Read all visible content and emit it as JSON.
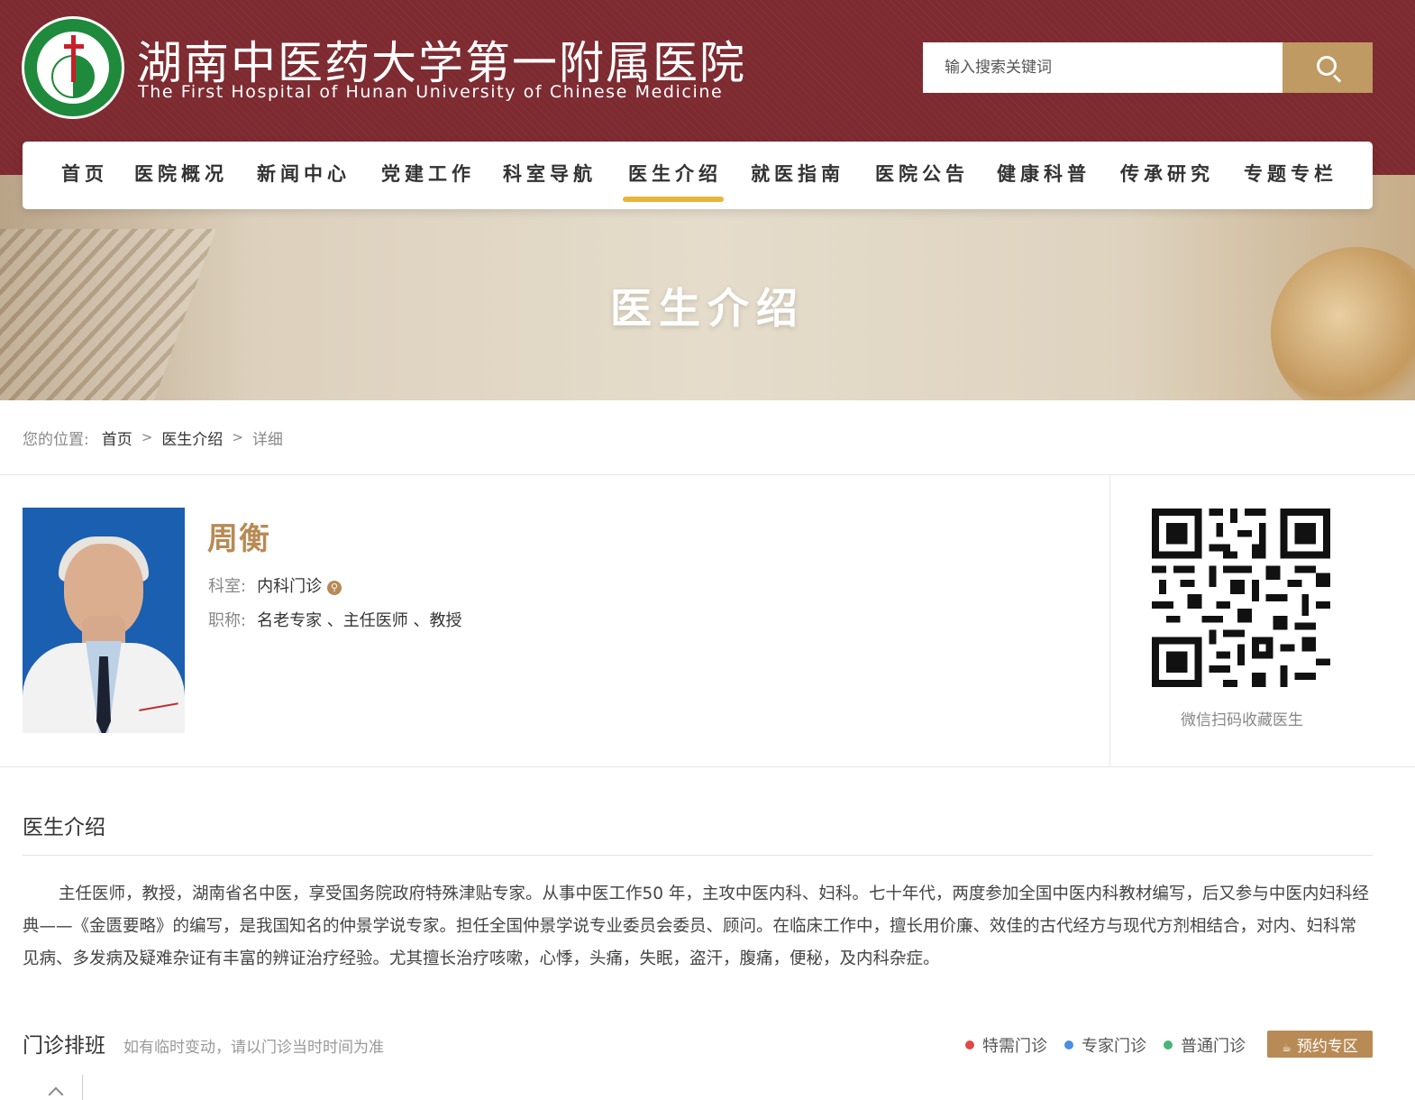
{
  "header": {
    "title": "湖南中医药大学第一附属医院",
    "subtitle": "The First Hospital of Hunan University of Chinese Medicine",
    "search_placeholder": "输入搜索关键词",
    "brand_color": "#7d2a30",
    "accent_color": "#c09a63"
  },
  "nav": {
    "items": [
      "首页",
      "医院概况",
      "新闻中心",
      "党建工作",
      "科室导航",
      "医生介绍",
      "就医指南",
      "医院公告",
      "健康科普",
      "传承研究",
      "专题专栏"
    ],
    "active": "医生介绍"
  },
  "banner": {
    "title": "医生介绍"
  },
  "breadcrumb": {
    "label": "您的位置:",
    "home": "首页",
    "section": "医生介绍",
    "current": "详细"
  },
  "doctor": {
    "name": "周衡",
    "dept_label": "科室:",
    "dept": "内科门诊",
    "title_label": "职称:",
    "title": "名老专家 、主任医师 、教授"
  },
  "qr": {
    "caption": "微信扫码收藏医生"
  },
  "intro": {
    "heading": "医生介绍",
    "text": "主任医师，教授，湖南省名中医，享受国务院政府特殊津贴专家。从事中医工作50 年，主攻中医内科、妇科。七十年代，两度参加全国中医内科教材编写，后又参与中医内妇科经典——《金匮要略》的编写，是我国知名的仲景学说专家。担任全国仲景学说专业委员会委员、顾问。在临床工作中，擅长用价廉、效佳的古代经方与现代方剂相结合，对内、妇科常见病、多发病及疑难杂证有丰富的辨证治疗经验。尤其擅长治疗咳嗽，心悸，头痛，失眠，盗汗，腹痛，便秘，及内科杂症。"
  },
  "schedule": {
    "heading": "门诊排班",
    "note": "如有临时变动，请以门诊当时时间为准",
    "legend": [
      {
        "label": "特需门诊",
        "color": "#e04848"
      },
      {
        "label": "专家门诊",
        "color": "#4a8fe0"
      },
      {
        "label": "普通门诊",
        "color": "#4cb47a"
      }
    ],
    "book_label": "预约专区"
  }
}
